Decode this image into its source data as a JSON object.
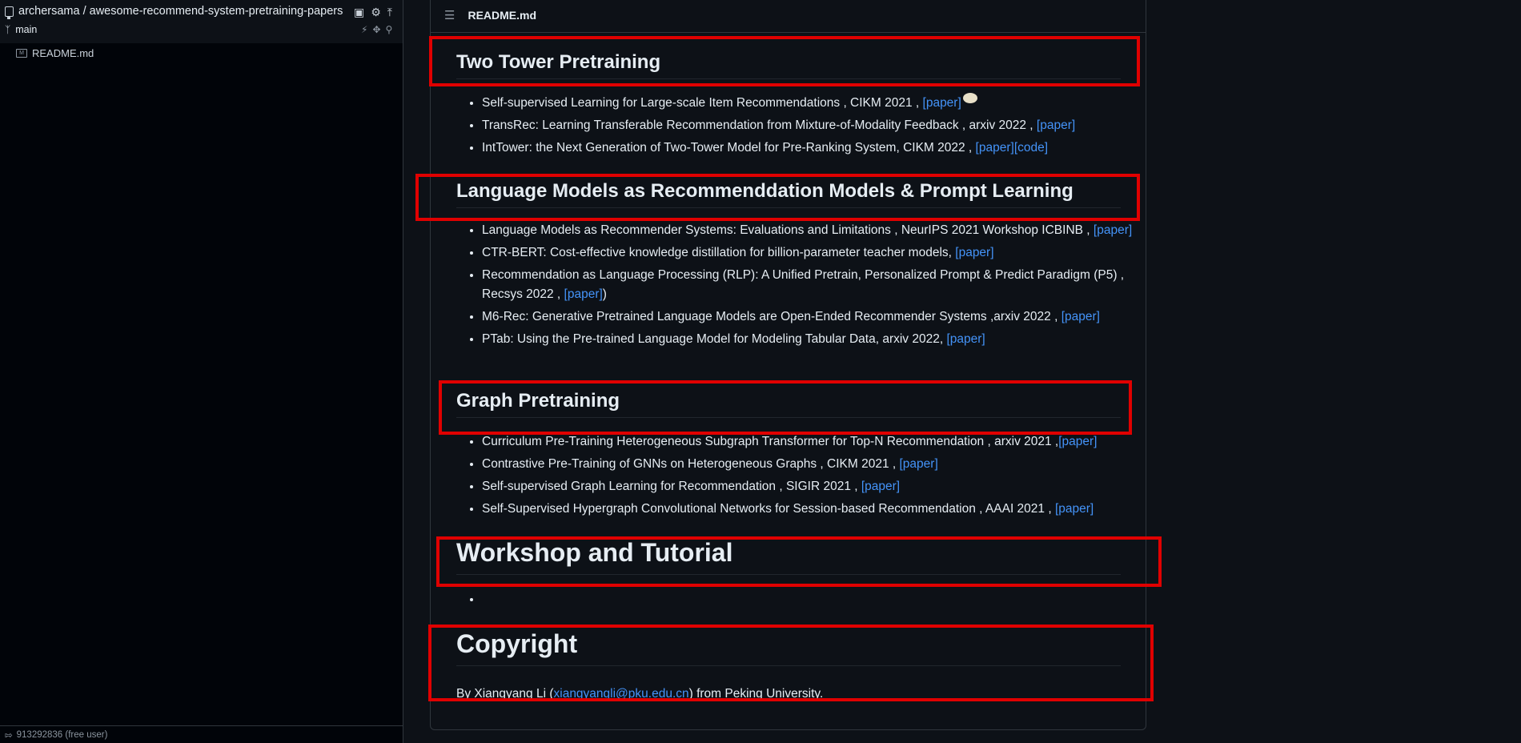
{
  "sidebar": {
    "repo_title": "archersama / awesome-recommend-system-pretraining-papers",
    "branch": "main",
    "file": "README.md",
    "footer_user": "913292836 (free user)"
  },
  "readme": {
    "header_title": "README.md",
    "sections": {
      "two_tower": {
        "heading": "Two Tower Pretraining",
        "items": [
          {
            "text": "Self-supervised Learning for Large-scale Item Recommendations , CIKM 2021 , ",
            "link": "[paper]"
          },
          {
            "text": "TransRec: Learning Transferable Recommendation from Mixture-of-Modality Feedback , arxiv 2022 , ",
            "link": "[paper]"
          },
          {
            "text": "IntTower: the Next Generation of Two-Tower Model for Pre-Ranking System, CIKM 2022 , ",
            "link": "[paper]",
            "link2": "[code]"
          }
        ]
      },
      "language": {
        "heading": "Language Models as Recommenddation Models & Prompt Learning",
        "items": [
          {
            "text": "Language Models as Recommender Systems: Evaluations and Limitations , NeurIPS 2021 Workshop ICBINB , ",
            "link": "[paper]"
          },
          {
            "text": "CTR-BERT: Cost-effective knowledge distillation for billion-parameter teacher models, ",
            "link": "[paper]"
          },
          {
            "text": "Recommendation as Language Processing (RLP): A Unified Pretrain, Personalized Prompt & Predict Paradigm (P5) , Recsys 2022 , ",
            "link": "[paper]",
            "suffix": ")"
          },
          {
            "text": "M6-Rec: Generative Pretrained Language Models are Open-Ended Recommender Systems ,arxiv 2022 , ",
            "link": "[paper]"
          },
          {
            "text": "PTab: Using the Pre-trained Language Model for Modeling Tabular Data, arxiv 2022, ",
            "link": "[paper]"
          }
        ]
      },
      "graph": {
        "heading": "Graph Pretraining",
        "items": [
          {
            "text": "Curriculum Pre-Training Heterogeneous Subgraph Transformer for Top-N Recommendation , arxiv 2021 ,",
            "link": "[paper]"
          },
          {
            "text": "Contrastive Pre-Training of GNNs on Heterogeneous Graphs , CIKM 2021 , ",
            "link": "[paper]"
          },
          {
            "text": "Self-supervised Graph Learning for Recommendation , SIGIR 2021 , ",
            "link": "[paper]"
          },
          {
            "text": "Self-Supervised Hypergraph Convolutional Networks for Session-based Recommendation , AAAI 2021 , ",
            "link": "[paper]"
          }
        ]
      },
      "workshop": {
        "heading": "Workshop and Tutorial"
      },
      "copyright": {
        "heading": "Copyright",
        "by": "By Xiangyang Li (",
        "email": "xiangyangli@pku.edu.cn",
        "from": ") from Peking University."
      }
    }
  },
  "colors": {
    "link": "#4493f8",
    "highlight": "#e00000",
    "background": "#0d1117"
  },
  "icons": [
    "repo-icon",
    "bookmark-icon",
    "gear-icon",
    "pin-icon",
    "branch-icon",
    "zap-icon",
    "move-icon",
    "search-icon",
    "markdown-file-icon",
    "list-icon",
    "sign-in-icon"
  ]
}
